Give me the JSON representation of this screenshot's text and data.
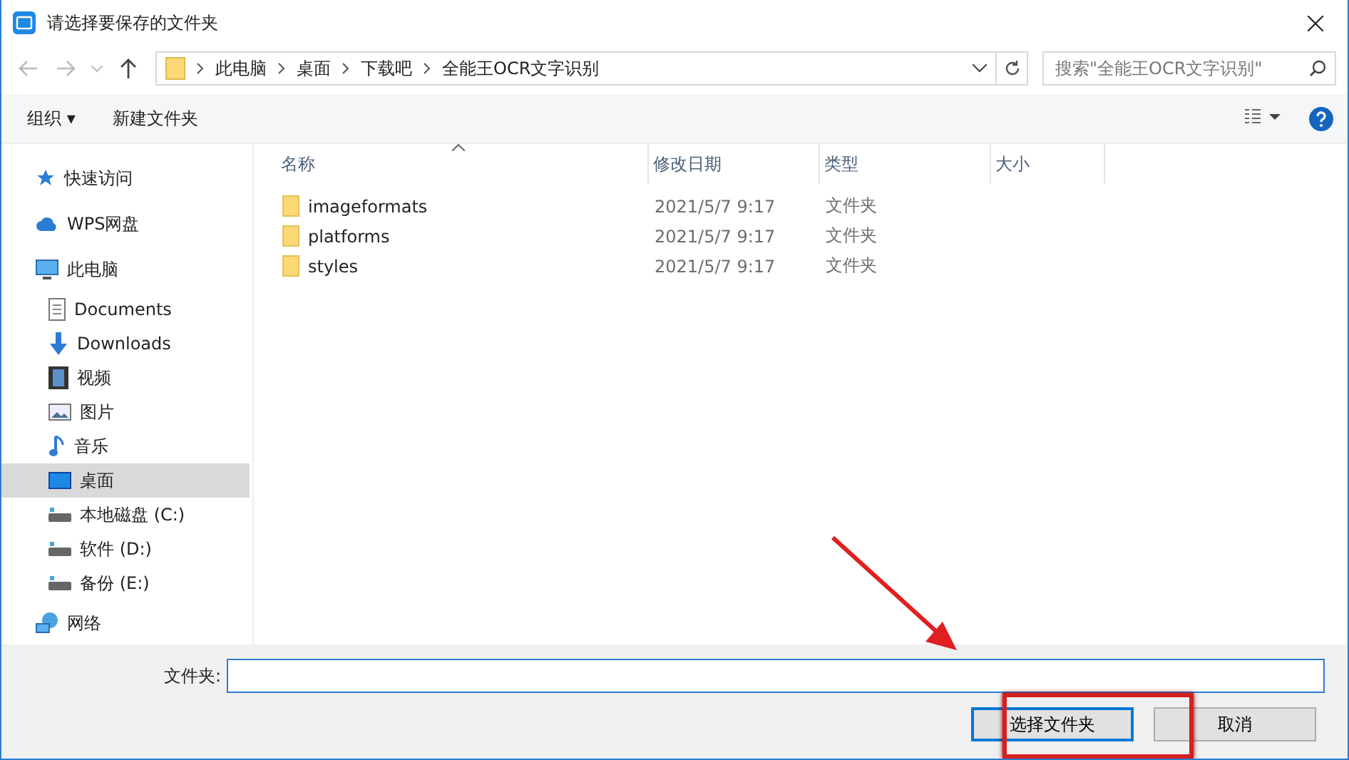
{
  "window": {
    "title": "请选择要保存的文件夹"
  },
  "address": {
    "path": [
      "此电脑",
      "桌面",
      "下载吧",
      "全能王OCR文字识别"
    ],
    "search_placeholder": "搜索\"全能王OCR文字识别\""
  },
  "toolbar": {
    "organize": "组织 ▾",
    "new_folder": "新建文件夹"
  },
  "sidebar": {
    "items": [
      {
        "label": "快速访问",
        "kind": "group",
        "selected": false
      },
      {
        "label": "WPS网盘",
        "kind": "group",
        "selected": false
      },
      {
        "label": "此电脑",
        "kind": "group",
        "selected": false
      },
      {
        "label": "Documents",
        "kind": "child",
        "selected": false
      },
      {
        "label": "Downloads",
        "kind": "child",
        "selected": false
      },
      {
        "label": "视频",
        "kind": "child",
        "selected": false
      },
      {
        "label": "图片",
        "kind": "child",
        "selected": false
      },
      {
        "label": "音乐",
        "kind": "child",
        "selected": false
      },
      {
        "label": "桌面",
        "kind": "child",
        "selected": true
      },
      {
        "label": "本地磁盘 (C:)",
        "kind": "child",
        "selected": false
      },
      {
        "label": "软件 (D:)",
        "kind": "child",
        "selected": false
      },
      {
        "label": "备份 (E:)",
        "kind": "child",
        "selected": false
      },
      {
        "label": "网络",
        "kind": "group",
        "selected": false
      }
    ]
  },
  "table": {
    "columns": [
      "名称",
      "修改日期",
      "类型",
      "大小"
    ],
    "rows": [
      {
        "name": "imageformats",
        "date": "2021/5/7 9:17",
        "type": "文件夹"
      },
      {
        "name": "platforms",
        "date": "2021/5/7 9:17",
        "type": "文件夹"
      },
      {
        "name": "styles",
        "date": "2021/5/7 9:17",
        "type": "文件夹"
      }
    ]
  },
  "footer": {
    "label": "文件夹:",
    "buttons": [
      {
        "label": "选择文件夹",
        "default": true
      },
      {
        "label": "取消",
        "default": false
      }
    ]
  }
}
